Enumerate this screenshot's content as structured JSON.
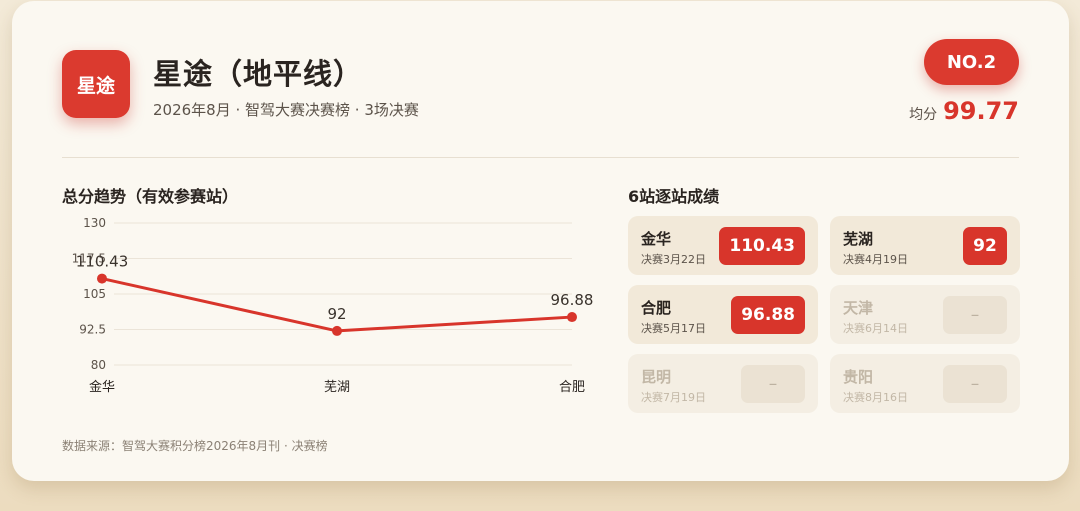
{
  "header": {
    "logo_text": "星途",
    "title": "星途（地平线）",
    "subtitle": "2026年8月 · 智驾大赛决赛榜 · 3场决赛",
    "rank": "NO.2",
    "avg_label": "均分",
    "avg_value": "99.77"
  },
  "chart_section": {
    "title": "总分趋势（有效参赛站）",
    "source": "数据来源：智驾大赛积分榜2026年8月刊 · 决赛榜"
  },
  "chart_data": {
    "type": "line",
    "categories": [
      "金华",
      "芜湖",
      "合肥"
    ],
    "values": [
      110.43,
      92,
      96.88
    ],
    "value_labels": [
      "110.43",
      "92",
      "96.88"
    ],
    "y_ticks": [
      "130",
      "117.5",
      "105",
      "92.5",
      "80"
    ],
    "ylim": [
      80,
      130
    ],
    "grid": true,
    "line_color": "#d8352b"
  },
  "stations_section": {
    "title": "6站逐站成绩",
    "stations": [
      {
        "name": "金华",
        "date": "决赛3月22日",
        "score": "110.43",
        "active": true
      },
      {
        "name": "芜湖",
        "date": "决赛4月19日",
        "score": "92",
        "active": true
      },
      {
        "name": "合肥",
        "date": "决赛5月17日",
        "score": "96.88",
        "active": true
      },
      {
        "name": "天津",
        "date": "决赛6月14日",
        "score": "–",
        "active": false
      },
      {
        "name": "昆明",
        "date": "决赛7月19日",
        "score": "–",
        "active": false
      },
      {
        "name": "贵阳",
        "date": "决赛8月16日",
        "score": "–",
        "active": false
      }
    ]
  },
  "colors": {
    "accent": "#d8352b",
    "card_bg": "#fbf8f1",
    "tile_bg": "#f2e9d9"
  }
}
